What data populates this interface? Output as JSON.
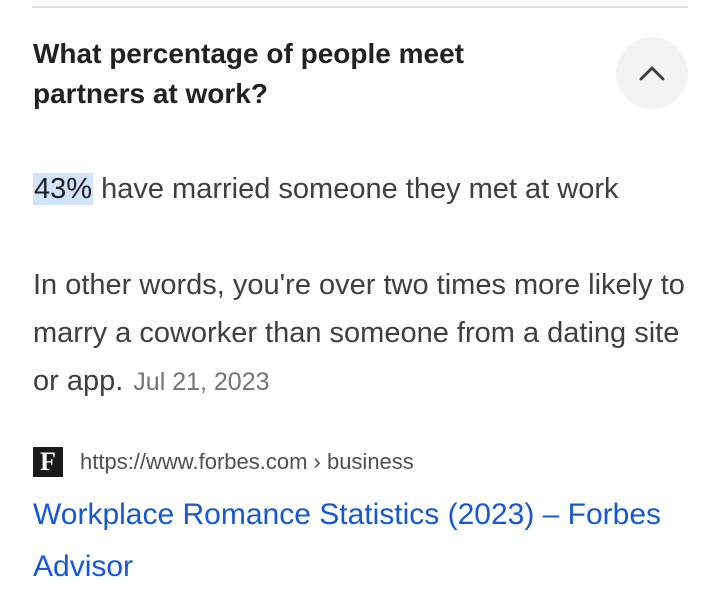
{
  "question": "What percentage of people meet partners at work?",
  "collapse_button": {
    "icon": "chevron-up-icon"
  },
  "answer": {
    "highlight": "43%",
    "text": " have married someone they met at work"
  },
  "detail": {
    "text": "In other words, you're over two times more likely to marry a coworker than someone from a dating site or app.",
    "date": "Jul 21, 2023"
  },
  "source": {
    "favicon_letter": "F",
    "url": "https://www.forbes.com › business",
    "title": "Workplace Romance Statistics (2023) – Forbes Advisor"
  },
  "colors": {
    "link": "#1558d6",
    "highlight": "#d2e3fc",
    "button_bg": "#f1f3f4"
  }
}
